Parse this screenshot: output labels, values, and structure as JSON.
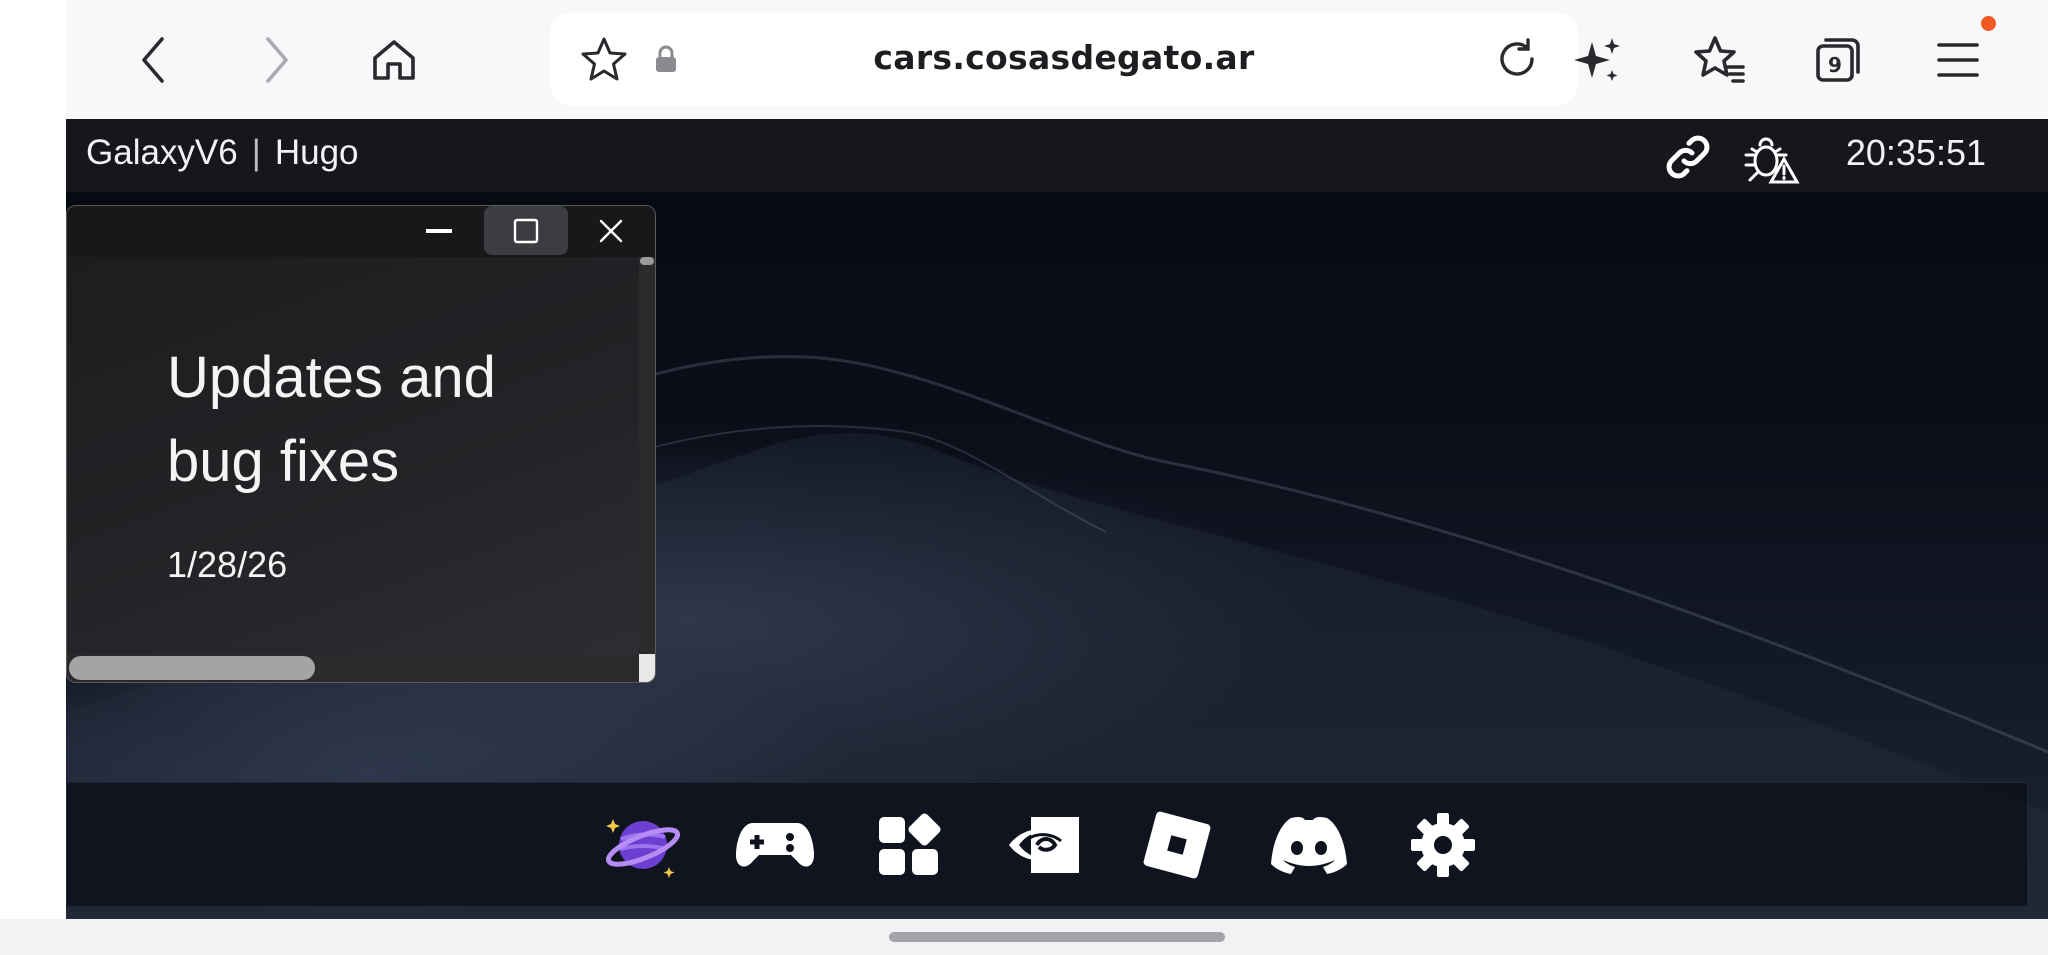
{
  "browser": {
    "url": "cars.cosasdegato.ar",
    "tab_count": "9",
    "icons": {
      "back": "chevron-left-icon",
      "forward": "chevron-right-icon",
      "home": "home-icon",
      "bookmark": "star-icon",
      "secure": "lock-icon",
      "reload": "reload-icon",
      "ai": "sparkles-icon",
      "bookmarks_list": "star-list-icon",
      "tabs": "tabs-icon",
      "menu": "hamburger-menu-icon"
    },
    "notification_color": "#f05a22"
  },
  "app": {
    "title": "GalaxyV6",
    "separator": "|",
    "user": "Hugo",
    "time": "20:35:51",
    "header_icons": [
      "link-icon",
      "bug-warning-icon"
    ]
  },
  "window": {
    "heading": "Updates and bug fixes",
    "date": "1/28/26",
    "controls": [
      "minimize-icon",
      "maximize-icon",
      "close-icon"
    ]
  },
  "taskbar": {
    "items": [
      {
        "icon": "planet-icon",
        "accent": "#8b5cf6"
      },
      {
        "icon": "gamepad-icon"
      },
      {
        "icon": "apps-grid-icon"
      },
      {
        "icon": "nvidia-icon"
      },
      {
        "icon": "roblox-icon"
      },
      {
        "icon": "discord-icon"
      },
      {
        "icon": "settings-gear-icon"
      }
    ]
  }
}
